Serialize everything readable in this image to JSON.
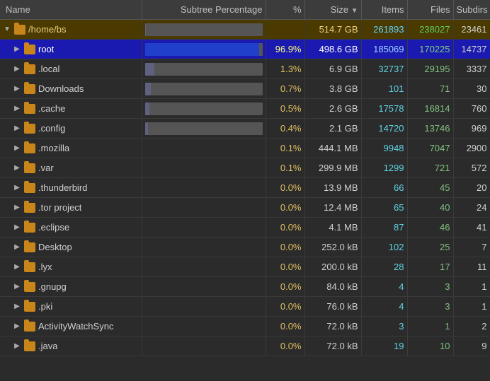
{
  "header": {
    "name": "Name",
    "subtree": "Subtree Percentage",
    "pct": "%",
    "size": "Size",
    "sort_arrow": "▼",
    "items": "Items",
    "files": "Files",
    "subdirs": "Subdirs"
  },
  "rows": [
    {
      "id": "home",
      "indent": 0,
      "expand": "▼",
      "name": "/home/bs",
      "bar_pct": 100,
      "pct": "",
      "size": "514.7 GB",
      "items": "261893",
      "files": "238027",
      "subdirs": "23461",
      "row_type": "home"
    },
    {
      "id": "root",
      "indent": 1,
      "expand": "▶",
      "name": "root",
      "bar_pct": 97,
      "pct": "96.9%",
      "size": "498.6 GB",
      "items": "185069",
      "files": "170225",
      "subdirs": "14737",
      "row_type": "root"
    },
    {
      "id": "local",
      "indent": 1,
      "expand": "▶",
      "name": ".local",
      "bar_pct": 3,
      "pct": "1.3%",
      "size": "6.9 GB",
      "items": "32737",
      "files": "29195",
      "subdirs": "3337",
      "row_type": "normal"
    },
    {
      "id": "downloads",
      "indent": 1,
      "expand": "▶",
      "name": "Downloads",
      "bar_pct": 1,
      "pct": "0.7%",
      "size": "3.8 GB",
      "items": "101",
      "files": "71",
      "subdirs": "30",
      "row_type": "normal"
    },
    {
      "id": "cache",
      "indent": 1,
      "expand": "▶",
      "name": ".cache",
      "bar_pct": 1,
      "pct": "0.5%",
      "size": "2.6 GB",
      "items": "17578",
      "files": "16814",
      "subdirs": "760",
      "row_type": "normal"
    },
    {
      "id": "config",
      "indent": 1,
      "expand": "▶",
      "name": ".config",
      "bar_pct": 1,
      "pct": "0.4%",
      "size": "2.1 GB",
      "items": "14720",
      "files": "13746",
      "subdirs": "969",
      "row_type": "normal"
    },
    {
      "id": "mozilla",
      "indent": 1,
      "expand": "▶",
      "name": ".mozilla",
      "bar_pct": 0,
      "pct": "0.1%",
      "size": "444.1 MB",
      "items": "9948",
      "files": "7047",
      "subdirs": "2900",
      "row_type": "normal"
    },
    {
      "id": "var",
      "indent": 1,
      "expand": "▶",
      "name": ".var",
      "bar_pct": 0,
      "pct": "0.1%",
      "size": "299.9 MB",
      "items": "1299",
      "files": "721",
      "subdirs": "572",
      "row_type": "normal"
    },
    {
      "id": "thunderbird",
      "indent": 1,
      "expand": "▶",
      "name": ".thunderbird",
      "bar_pct": 0,
      "pct": "0.0%",
      "size": "13.9 MB",
      "items": "66",
      "files": "45",
      "subdirs": "20",
      "row_type": "normal"
    },
    {
      "id": "torproject",
      "indent": 1,
      "expand": "▶",
      "name": ".tor project",
      "bar_pct": 0,
      "pct": "0.0%",
      "size": "12.4 MB",
      "items": "65",
      "files": "40",
      "subdirs": "24",
      "row_type": "normal"
    },
    {
      "id": "eclipse",
      "indent": 1,
      "expand": "▶",
      "name": ".eclipse",
      "bar_pct": 0,
      "pct": "0.0%",
      "size": "4.1 MB",
      "items": "87",
      "files": "46",
      "subdirs": "41",
      "row_type": "normal"
    },
    {
      "id": "desktop",
      "indent": 1,
      "expand": "▶",
      "name": "Desktop",
      "bar_pct": 0,
      "pct": "0.0%",
      "size": "252.0 kB",
      "items": "102",
      "files": "25",
      "subdirs": "7",
      "row_type": "normal"
    },
    {
      "id": "lyx",
      "indent": 1,
      "expand": "▶",
      "name": ".lyx",
      "bar_pct": 0,
      "pct": "0.0%",
      "size": "200.0 kB",
      "items": "28",
      "files": "17",
      "subdirs": "11",
      "row_type": "normal"
    },
    {
      "id": "gnupg",
      "indent": 1,
      "expand": "▶",
      "name": ".gnupg",
      "bar_pct": 0,
      "pct": "0.0%",
      "size": "84.0 kB",
      "items": "4",
      "files": "3",
      "subdirs": "1",
      "row_type": "normal"
    },
    {
      "id": "pki",
      "indent": 1,
      "expand": "▶",
      "name": ".pki",
      "bar_pct": 0,
      "pct": "0.0%",
      "size": "76.0 kB",
      "items": "4",
      "files": "3",
      "subdirs": "1",
      "row_type": "normal"
    },
    {
      "id": "activitywatchsync",
      "indent": 1,
      "expand": "▶",
      "name": "ActivityWatchSync",
      "bar_pct": 0,
      "pct": "0.0%",
      "size": "72.0 kB",
      "items": "3",
      "files": "1",
      "subdirs": "2",
      "row_type": "normal"
    },
    {
      "id": "java",
      "indent": 1,
      "expand": "▶",
      "name": ".java",
      "bar_pct": 0,
      "pct": "0.0%",
      "size": "72.0 kB",
      "items": "19",
      "files": "10",
      "subdirs": "9",
      "row_type": "normal"
    }
  ]
}
